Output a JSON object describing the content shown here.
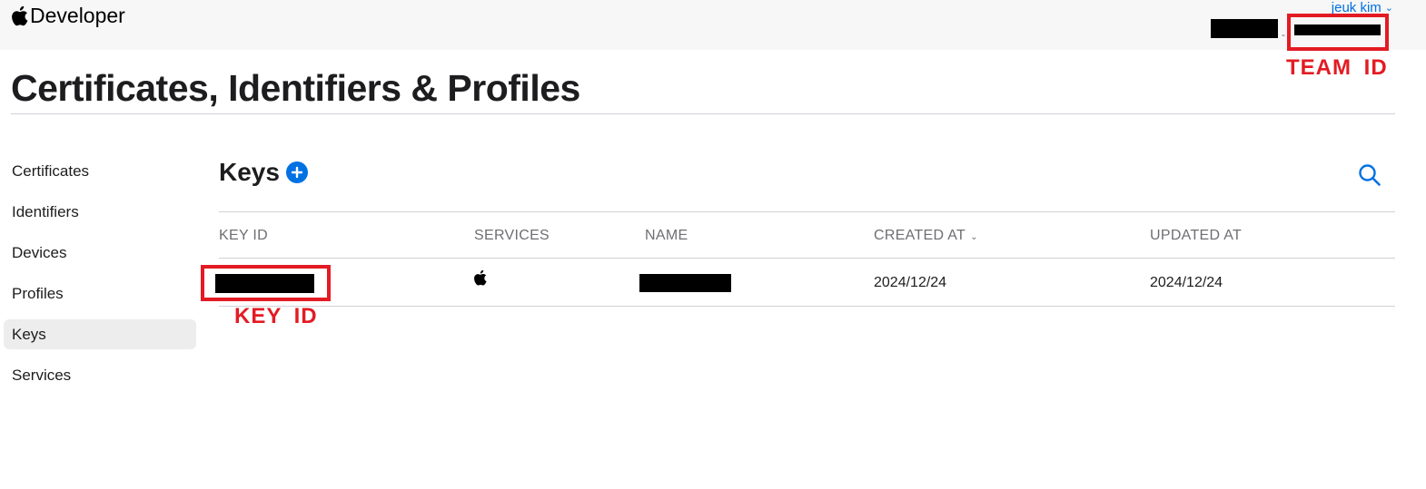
{
  "header": {
    "brand": "Developer",
    "account_name": "jeuk kim"
  },
  "page": {
    "title": "Certificates, Identifiers & Profiles"
  },
  "sidebar": {
    "items": [
      {
        "label": "Certificates"
      },
      {
        "label": "Identifiers"
      },
      {
        "label": "Devices"
      },
      {
        "label": "Profiles"
      },
      {
        "label": "Keys",
        "active": true
      },
      {
        "label": "Services"
      }
    ]
  },
  "section": {
    "title": "Keys"
  },
  "table": {
    "headers": {
      "key_id": "KEY ID",
      "services": "SERVICES",
      "name": "NAME",
      "created_at": "CREATED AT",
      "updated_at": "UPDATED AT"
    },
    "sort_column": "created_at",
    "rows": [
      {
        "key_id": "",
        "services_icon": "apple-icon",
        "name": "",
        "created_at": "2024/12/24",
        "updated_at": "2024/12/24"
      }
    ]
  },
  "annotations": {
    "team_id_label": "TEAM ID",
    "key_id_label": "KEY ID",
    "color": "#e31b23"
  },
  "colors": {
    "accent": "#0071e3",
    "topbar_bg": "#f7f7f7",
    "active_nav_bg": "#ededed",
    "annotation": "#e31b23"
  }
}
